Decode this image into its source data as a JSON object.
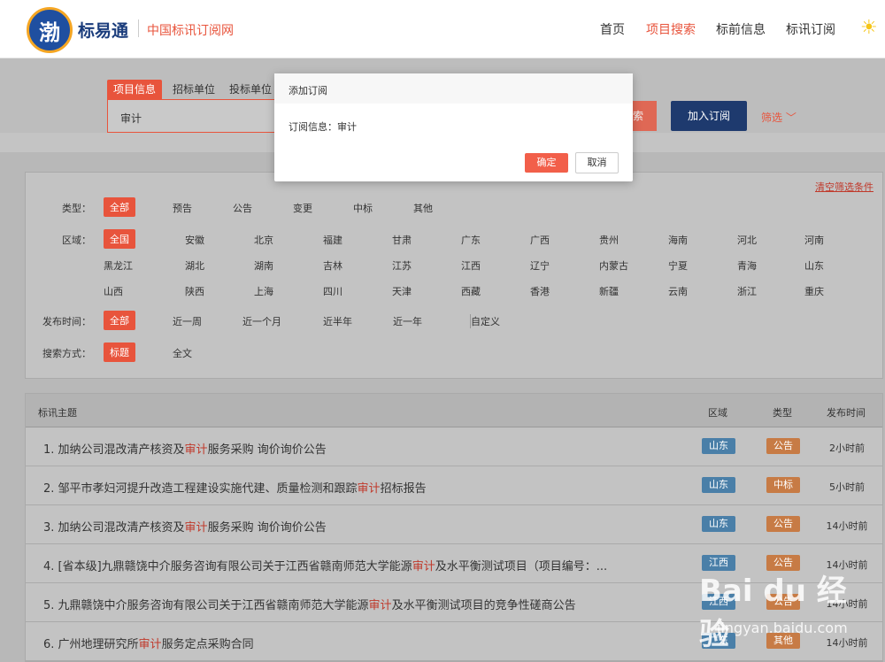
{
  "header": {
    "logo_text": "渤",
    "brand": "标易通",
    "slogan": "中国标讯订阅网",
    "nav": [
      "首页",
      "项目搜索",
      "标前信息",
      "标讯订阅"
    ],
    "active_nav": 1
  },
  "search": {
    "tabs": [
      "项目信息",
      "招标单位",
      "投标单位"
    ],
    "query": "审计",
    "search_btn": "索",
    "subscribe_btn": "加入订阅",
    "filter_link": "筛选"
  },
  "filters": {
    "clear": "清空筛选条件",
    "type_label": "类型：",
    "types": [
      "全部",
      "预告",
      "公告",
      "变更",
      "中标",
      "其他"
    ],
    "region_label": "区域：",
    "regions": [
      [
        "全国",
        "安徽",
        "北京",
        "福建",
        "甘肃",
        "广东",
        "广西",
        "贵州",
        "海南",
        "河北",
        "河南"
      ],
      [
        "黑龙江",
        "湖北",
        "湖南",
        "吉林",
        "江苏",
        "江西",
        "辽宁",
        "内蒙古",
        "宁夏",
        "青海",
        "山东"
      ],
      [
        "山西",
        "陕西",
        "上海",
        "四川",
        "天津",
        "西藏",
        "香港",
        "新疆",
        "云南",
        "浙江",
        "重庆"
      ]
    ],
    "time_label": "发布时间：",
    "times": [
      "全部",
      "近一周",
      "近一个月",
      "近半年",
      "近一年",
      "自定义"
    ],
    "mode_label": "搜索方式：",
    "modes": [
      "标题",
      "全文"
    ]
  },
  "results": {
    "headers": {
      "title": "标讯主题",
      "region": "区域",
      "type": "类型",
      "time": "发布时间"
    },
    "rows": [
      {
        "pre": "1. 加纳公司混改清产核资及",
        "hl": "审计",
        "post": "服务采购 询价询价公告",
        "region": "山东",
        "type": "公告",
        "time": "2小时前"
      },
      {
        "pre": "2. 邹平市孝妇河提升改造工程建设实施代建、质量检测和跟踪",
        "hl": "审计",
        "post": "招标报告",
        "region": "山东",
        "type": "中标",
        "time": "5小时前"
      },
      {
        "pre": "3. 加纳公司混改清产核资及",
        "hl": "审计",
        "post": "服务采购 询价询价公告",
        "region": "山东",
        "type": "公告",
        "time": "14小时前"
      },
      {
        "pre": "4. [省本级]九鼎赣饶中介服务咨询有限公司关于江西省赣南师范大学能源",
        "hl": "审计",
        "post": "及水平衡测试项目（项目编号：...",
        "region": "江西",
        "type": "公告",
        "time": "14小时前"
      },
      {
        "pre": "5. 九鼎赣饶中介服务咨询有限公司关于江西省赣南师范大学能源",
        "hl": "审计",
        "post": "及水平衡测试项目的竞争性磋商公告",
        "region": "江西",
        "type": "公告",
        "time": "14小时前"
      },
      {
        "pre": "6. 广州地理研究所",
        "hl": "审计",
        "post": "服务定点采购合同",
        "region": "广东",
        "type": "其他",
        "time": "14小时前"
      }
    ]
  },
  "modal": {
    "title": "添加订阅",
    "info_label": "订阅信息：",
    "info_value": "审计",
    "ok": "确定",
    "cancel": "取消"
  },
  "watermark": {
    "brand": "Bai du 经验",
    "url": "jingyan.baidu.com"
  },
  "colors": {
    "accent": "#e8543c",
    "navy": "#1e3a6e",
    "region_tag": "#4a7fa8",
    "type_tag": "#c77b45"
  }
}
